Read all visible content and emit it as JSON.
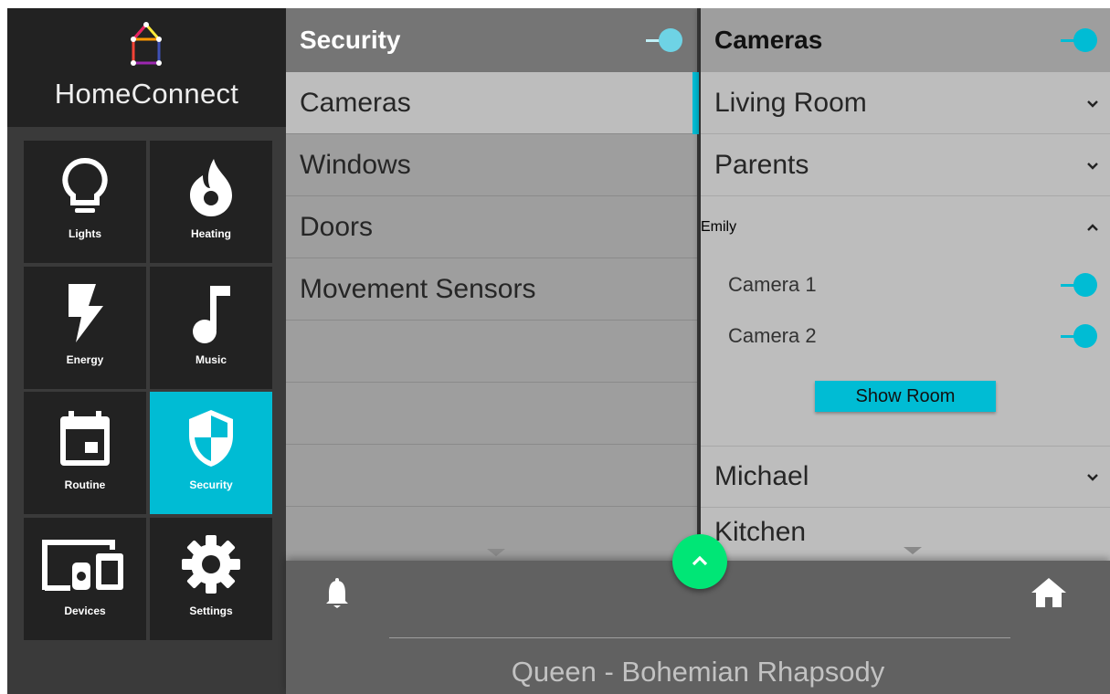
{
  "app": {
    "name": "HomeConnect"
  },
  "sidebar": {
    "tiles": [
      {
        "label": "Lights",
        "icon": "lightbulb-icon"
      },
      {
        "label": "Heating",
        "icon": "flame-icon"
      },
      {
        "label": "Energy",
        "icon": "lightning-icon"
      },
      {
        "label": "Music",
        "icon": "music-note-icon"
      },
      {
        "label": "Routine",
        "icon": "calendar-icon"
      },
      {
        "label": "Security",
        "icon": "shield-icon",
        "active": true
      },
      {
        "label": "Devices",
        "icon": "devices-icon"
      },
      {
        "label": "Settings",
        "icon": "gear-icon"
      }
    ]
  },
  "security": {
    "title": "Security",
    "enabled": true,
    "items": [
      "Cameras",
      "Windows",
      "Doors",
      "Movement Sensors"
    ],
    "selected": "Cameras"
  },
  "cameras": {
    "title": "Cameras",
    "enabled": true,
    "rooms": [
      {
        "name": "Living Room",
        "expanded": false
      },
      {
        "name": "Parents",
        "expanded": false
      },
      {
        "name": "Emily",
        "expanded": true
      },
      {
        "name": "Michael",
        "expanded": false
      },
      {
        "name": "Kitchen",
        "expanded": false
      }
    ],
    "emily_cameras": [
      {
        "name": "Camera 1",
        "on": true
      },
      {
        "name": "Camera 2",
        "on": true
      }
    ],
    "show_room_label": "Show Room"
  },
  "footer": {
    "now_playing": "Queen - Bohemian Rhapsody"
  },
  "colors": {
    "accent": "#00bcd4",
    "fab": "#00e676"
  }
}
